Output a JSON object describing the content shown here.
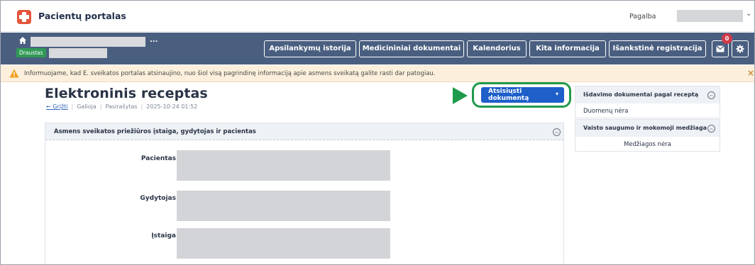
{
  "app": {
    "title": "Pacientų portalas",
    "help_label": "Pagalba"
  },
  "patient": {
    "insured_badge": "Draustas",
    "ellipsis": "..."
  },
  "nav": {
    "items": [
      "Apsilankymų istorija",
      "Medicininiai dokumentai",
      "Kalendorius",
      "Kita informacija",
      "Išankstinė registracija"
    ],
    "notification_count": "0"
  },
  "info_banner": {
    "text": "Informuojame, kad E. sveikatos portalas atsinaujino, nuo šiol visą pagrindinę informaciją apie asmens sveikatą galite rasti dar patogiau.",
    "close_glyph": "×"
  },
  "document": {
    "title": "Elektroninis receptas",
    "back_link": "← Grįžti",
    "validity": "Galioja",
    "status": "Pasirašytas",
    "datetime": "2025-10-24 01:52",
    "download_button": "Atsisiųsti dokumentą"
  },
  "section": {
    "title": "Asmens sveikatos priežiūros įstaiga, gydytojas ir pacientas",
    "fields": [
      {
        "label": "Pacientas"
      },
      {
        "label": "Gydytojas"
      },
      {
        "label": "Įstaiga"
      }
    ]
  },
  "sidebar": {
    "cards": [
      {
        "title": "Išdavimo dokumentai pagal receptą",
        "body": "Duomenų nėra"
      },
      {
        "title": "Vaisto saugumo ir mokomoji medžiaga",
        "body": "Medžiagos nėra"
      }
    ]
  },
  "colors": {
    "nav_bg": "#4a5f80",
    "primary_button": "#1f5fc9",
    "highlight_green": "#1f9a4b",
    "banner_bg": "#fcefdc",
    "brand_red": "#e4553c"
  }
}
